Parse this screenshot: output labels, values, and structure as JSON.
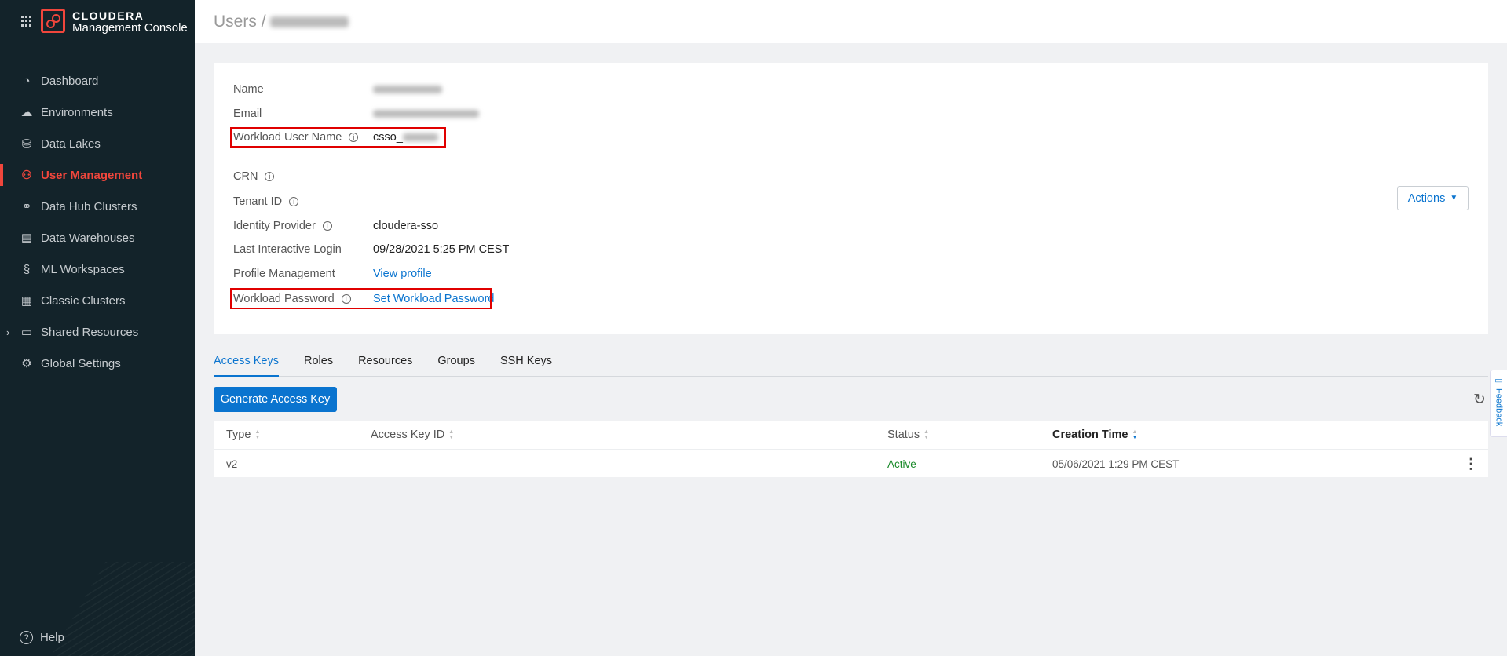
{
  "app": {
    "brand": "CLOUDERA",
    "product": "Management Console"
  },
  "sidebar": {
    "items": [
      {
        "label": "Dashboard",
        "icon": "gauge-icon"
      },
      {
        "label": "Environments",
        "icon": "cloud-icon"
      },
      {
        "label": "Data Lakes",
        "icon": "data-lake-icon"
      },
      {
        "label": "User Management",
        "icon": "users-icon",
        "active": true
      },
      {
        "label": "Data Hub Clusters",
        "icon": "cluster-icon"
      },
      {
        "label": "Data Warehouses",
        "icon": "warehouse-icon"
      },
      {
        "label": "ML Workspaces",
        "icon": "ml-icon"
      },
      {
        "label": "Classic Clusters",
        "icon": "server-icon"
      },
      {
        "label": "Shared Resources",
        "icon": "folder-icon"
      },
      {
        "label": "Global Settings",
        "icon": "gear-icon"
      }
    ],
    "help": "Help"
  },
  "header": {
    "breadcrumb_root": "Users",
    "separator": "/"
  },
  "details": {
    "name_label": "Name",
    "email_label": "Email",
    "workload_user_label": "Workload User Name",
    "workload_user_value_prefix": "csso_",
    "crn_label": "CRN",
    "tenant_label": "Tenant ID",
    "idp_label": "Identity Provider",
    "idp_value": "cloudera-sso",
    "last_login_label": "Last Interactive Login",
    "last_login_value": "09/28/2021 5:25 PM CEST",
    "profile_label": "Profile Management",
    "profile_link": "View profile",
    "password_label": "Workload Password",
    "password_link": "Set Workload Password",
    "actions": "Actions"
  },
  "tabs": [
    "Access Keys",
    "Roles",
    "Resources",
    "Groups",
    "SSH Keys"
  ],
  "generate_button": "Generate Access Key",
  "table": {
    "columns": [
      "Type",
      "Access Key ID",
      "Status",
      "Creation Time"
    ],
    "rows": [
      {
        "type": "v2",
        "access_key_id": "",
        "status": "Active",
        "creation_time": "05/06/2021 1:29 PM CEST"
      }
    ]
  },
  "feedback": "Feedback",
  "colors": {
    "accent": "#0a74cf",
    "brand": "#f0463c",
    "active_status": "#1a8a2a",
    "sidebar": "#13232a"
  }
}
